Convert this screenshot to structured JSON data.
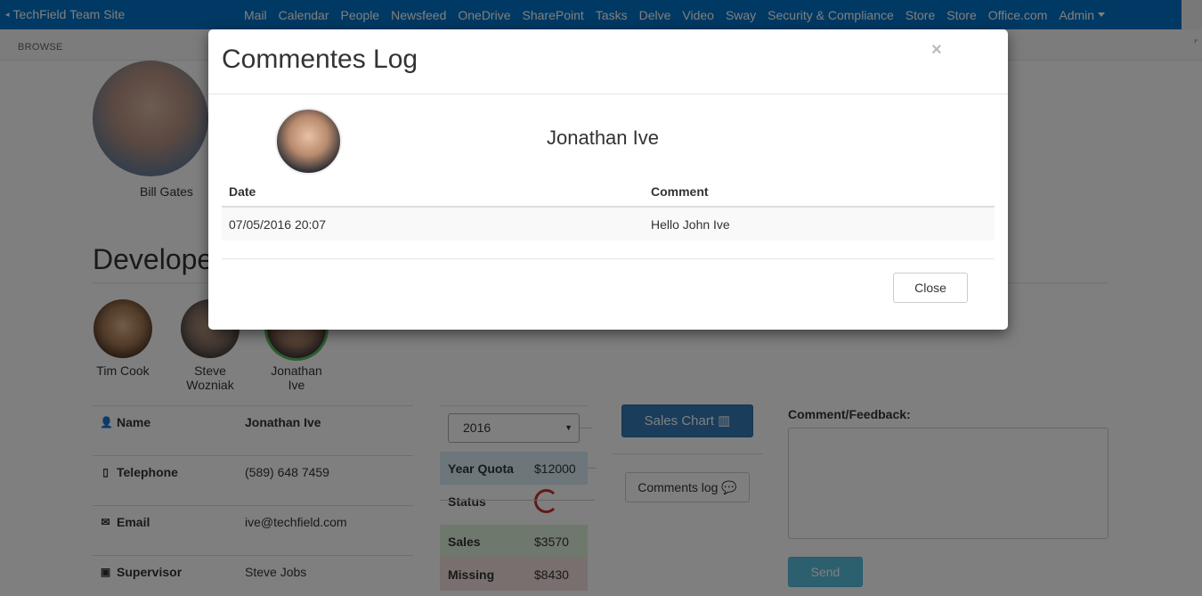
{
  "suitebar": {
    "site_title": "TechField Team Site",
    "nav": [
      "Mail",
      "Calendar",
      "People",
      "Newsfeed",
      "OneDrive",
      "SharePoint",
      "Tasks",
      "Delve",
      "Video",
      "Sway",
      "Security & Compliance",
      "Store",
      "Store",
      "Office.com"
    ],
    "admin_label": "Admin"
  },
  "ribbon": {
    "browse_label": "BROWSE"
  },
  "page": {
    "featured_name": "Bill Gates",
    "section_title": "Developers",
    "people": [
      {
        "name_line1": "Tim Cook",
        "name_line2": ""
      },
      {
        "name_line1": "Steve",
        "name_line2": "Wozniak"
      },
      {
        "name_line1": "Jonathan",
        "name_line2": "Ive"
      }
    ],
    "info": {
      "name_label": "Name",
      "name_value": "Jonathan Ive",
      "tel_label": "Telephone",
      "tel_value": "(589) 648 7459",
      "email_label": "Email",
      "email_value": "ive@techfield.com",
      "supervisor_label": "Supervisor",
      "supervisor_value": "Steve Jobs"
    },
    "quota": {
      "year_selected": "2016",
      "year_quota_label": "Year Quota",
      "year_quota_value": "$12000",
      "status_label": "Status",
      "sales_label": "Sales",
      "sales_value": "$3570",
      "missing_label": "Missing",
      "missing_value": "$8430"
    },
    "buttons": {
      "sales_chart": "Sales Chart",
      "comments_log": "Comments log",
      "send": "Send"
    },
    "feedback_label": "Comment/Feedback:"
  },
  "modal": {
    "title": "Commentes Log",
    "close_x": "×",
    "person_name": "Jonathan Ive",
    "columns": [
      "Date",
      "Comment"
    ],
    "rows": [
      {
        "date": "07/05/2016 20:07",
        "comment": "Hello John Ive"
      }
    ],
    "close_button": "Close"
  },
  "colors": {
    "suitebar": "#0072c6",
    "primary": "#337ab7",
    "info": "#5bc0de",
    "quota": "#d9edf7",
    "sales": "#dff0d8",
    "missing": "#f2dede"
  }
}
